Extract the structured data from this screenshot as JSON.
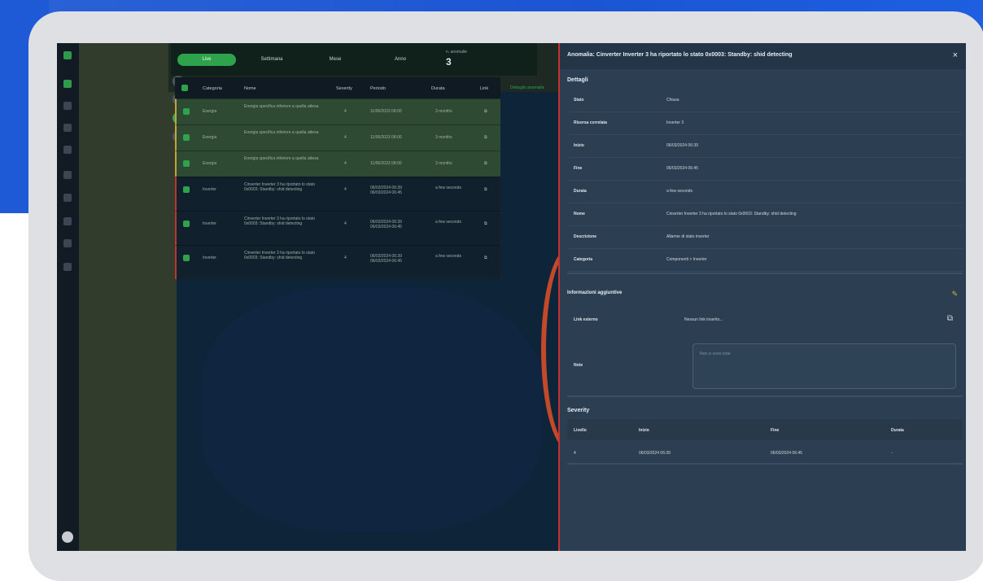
{
  "drawer": {
    "title": "Anomalia: Cinverter Inverter 3 ha riportato lo stato 0x0003: Standby: shid detecting",
    "close": "×",
    "details_title": "Dettagli",
    "details": [
      {
        "key": "Stato",
        "value": "Chiusa"
      },
      {
        "key": "Risorsa correlata",
        "value": "Inverter 3"
      },
      {
        "key": "Inizio",
        "value": "06/03/2024 06:39"
      },
      {
        "key": "Fine",
        "value": "06/03/2024 06:45"
      },
      {
        "key": "Durata",
        "value": "a few seconds"
      },
      {
        "key": "Nome",
        "value": "Cinverter Inverter 3 ha riportato lo stato 0x0003: Standby: shid detecting"
      },
      {
        "key": "Descrizione",
        "value": "Allarme di stato inverter"
      },
      {
        "key": "Categoria",
        "value": "Componenti > Inverter"
      }
    ],
    "extra_title": "Informazioni aggiuntive",
    "external_link_label": "Link esterno",
    "external_link_value": "Nessun link inserito...",
    "note_label": "Note",
    "note_placeholder": "Non ci sono note",
    "severity_title": "Severity",
    "severity_columns": [
      "Livello",
      "Inizio",
      "Fine",
      "Durata"
    ],
    "severity_rows": [
      {
        "level": "4",
        "start": "06/03/2024 06:39",
        "end": "06/03/2024 06:45",
        "duration": "-"
      }
    ]
  },
  "list": {
    "filters": [
      "Live",
      "Settimana",
      "Mese",
      "Anno"
    ],
    "counter_label": "n. anomalie",
    "counter_value": "3",
    "columns": [
      "Categoria",
      "Nome",
      "Severity",
      "Periodo",
      "Durata",
      "Link"
    ],
    "rows": [
      {
        "category": "Energia",
        "name": "Energia specifica inferiore a quella attesa",
        "severity": "4",
        "period": "11/06/2023 08:00",
        "duration": "3 months"
      },
      {
        "category": "Energia",
        "name": "Energia specifica inferiore a quella attesa",
        "severity": "4",
        "period": "11/06/2023 08:00",
        "duration": "3 months"
      },
      {
        "category": "Energia",
        "name": "Energia specifica inferiore a quella attesa",
        "severity": "4",
        "period": "11/06/2023 08:00",
        "duration": "3 months"
      },
      {
        "category": "Inverter",
        "name": "Cinverter Inverter 3 ha riportato lo stato 0x0003: Standby: shid detecting",
        "severity": "4",
        "period": "06/03/2024 06:39 06/03/2024 06:45",
        "duration": "a few seconds"
      },
      {
        "category": "Inverter",
        "name": "Cinverter Inverter 3 ha riportato lo stato 0x0003: Standby: shid detecting",
        "severity": "4",
        "period": "06/03/2024 06:39 06/03/2024 06:45",
        "duration": "a few seconds"
      },
      {
        "category": "Inverter",
        "name": "Cinverter Inverter 3 ha riportato lo stato 0x0003: Standby: shid detecting",
        "severity": "4",
        "period": "06/03/2024 06:39 06/03/2024 06:45",
        "duration": "a few seconds"
      }
    ],
    "link_text": "Dettaglio anomalia"
  },
  "colors": {
    "accent_green": "#2ea34c",
    "alert_red": "#c23232",
    "energy_yellow": "#c8a23a",
    "drawer_bg": "#2c3f52"
  }
}
